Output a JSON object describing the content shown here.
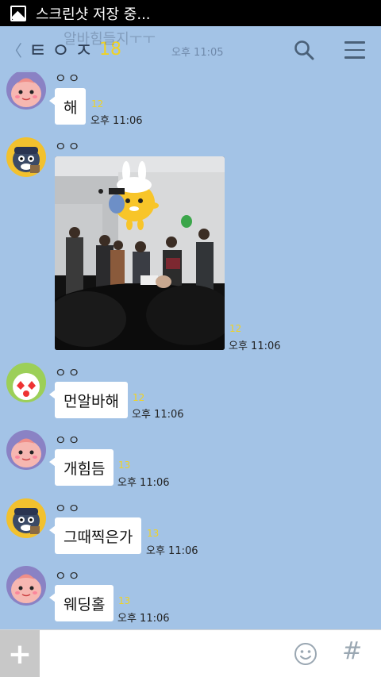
{
  "status_bar": {
    "text": "스크린샷 저장 중..."
  },
  "header": {
    "back_glyph": "〈",
    "title": "ㅌㅇㅈ",
    "member_count": "18",
    "notice_ghost": "알바힘들지ㅜㅜ",
    "notice_time": "오후 11:05"
  },
  "messages": [
    {
      "sender": "ㅇㅇ",
      "text": "해",
      "unread": "12",
      "time": "오후 11:06",
      "avatar": "apeach-avatar"
    },
    {
      "sender": "ㅇㅇ",
      "type": "photo",
      "unread": "12",
      "time": "오후 11:06",
      "avatar": "frodo-avatar"
    },
    {
      "sender": "ㅇㅇ",
      "text": "먼알바해",
      "unread": "12",
      "time": "오후 11:06",
      "avatar": "muzi-avatar"
    },
    {
      "sender": "ㅇㅇ",
      "text": "개힘듬",
      "unread": "13",
      "time": "오후 11:06",
      "avatar": "apeach-avatar"
    },
    {
      "sender": "ㅇㅇ",
      "text": "그때찍은가",
      "unread": "13",
      "time": "오후 11:06",
      "avatar": "frodo-avatar"
    },
    {
      "sender": "ㅇㅇ",
      "text": "웨딩홀",
      "unread": "13",
      "time": "오후 11:06",
      "avatar": "apeach-avatar"
    }
  ],
  "input_bar": {
    "plus_glyph": "+",
    "placeholder": "",
    "hash_glyph": "#"
  },
  "colors": {
    "background": "#a3c3e6",
    "unread": "#f0d322",
    "header_title": "#2f3f55"
  }
}
